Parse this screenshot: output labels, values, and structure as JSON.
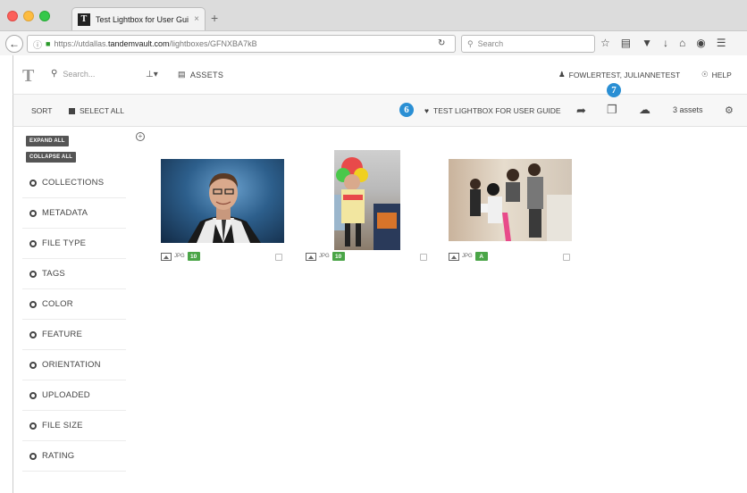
{
  "browser": {
    "tab_title": "Test Lightbox for User Gui...",
    "tab_close": "×",
    "new_tab": "+",
    "url_prefix": "https://utdallas.",
    "url_domain": "tandemvault.com",
    "url_path": "/lightboxes/GFNXBA7kB",
    "search_placeholder": "Search"
  },
  "app": {
    "logo": "T",
    "search_placeholder": "Search...",
    "assets_label": "ASSETS",
    "user_label": "FOWLERTEST, JULIANNETEST",
    "help_label": "HELP"
  },
  "toolbar": {
    "sort_label": "SORT",
    "select_all_label": "SELECT ALL",
    "lightbox_title": "TEST LIGHTBOX FOR USER GUIDE",
    "asset_count": "3 assets",
    "callout_6": "6",
    "callout_7": "7"
  },
  "sidebar": {
    "expand_all": "EXPAND ALL",
    "collapse_all": "COLLAPSE ALL",
    "facets": [
      {
        "label": "COLLECTIONS"
      },
      {
        "label": "METADATA"
      },
      {
        "label": "FILE TYPE"
      },
      {
        "label": "TAGS"
      },
      {
        "label": "COLOR"
      },
      {
        "label": "FEATURE"
      },
      {
        "label": "ORIENTATION"
      },
      {
        "label": "UPLOADED"
      },
      {
        "label": "FILE SIZE"
      },
      {
        "label": "RATING"
      }
    ]
  },
  "assets": [
    {
      "type": "JPG",
      "rating": "10"
    },
    {
      "type": "JPG",
      "rating": "10"
    },
    {
      "type": "JPG",
      "rating": "A"
    }
  ],
  "colors": {
    "accent_blue": "#2a8fd4",
    "rating_green": "#4aa547"
  }
}
